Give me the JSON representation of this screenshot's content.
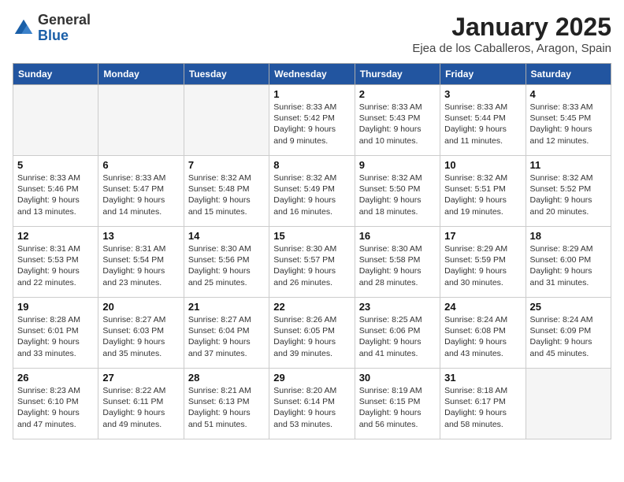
{
  "header": {
    "logo_general": "General",
    "logo_blue": "Blue",
    "month_title": "January 2025",
    "location": "Ejea de los Caballeros, Aragon, Spain"
  },
  "weekdays": [
    "Sunday",
    "Monday",
    "Tuesday",
    "Wednesday",
    "Thursday",
    "Friday",
    "Saturday"
  ],
  "weeks": [
    [
      {
        "day": "",
        "info": ""
      },
      {
        "day": "",
        "info": ""
      },
      {
        "day": "",
        "info": ""
      },
      {
        "day": "1",
        "info": "Sunrise: 8:33 AM\nSunset: 5:42 PM\nDaylight: 9 hours and 9 minutes."
      },
      {
        "day": "2",
        "info": "Sunrise: 8:33 AM\nSunset: 5:43 PM\nDaylight: 9 hours and 10 minutes."
      },
      {
        "day": "3",
        "info": "Sunrise: 8:33 AM\nSunset: 5:44 PM\nDaylight: 9 hours and 11 minutes."
      },
      {
        "day": "4",
        "info": "Sunrise: 8:33 AM\nSunset: 5:45 PM\nDaylight: 9 hours and 12 minutes."
      }
    ],
    [
      {
        "day": "5",
        "info": "Sunrise: 8:33 AM\nSunset: 5:46 PM\nDaylight: 9 hours and 13 minutes."
      },
      {
        "day": "6",
        "info": "Sunrise: 8:33 AM\nSunset: 5:47 PM\nDaylight: 9 hours and 14 minutes."
      },
      {
        "day": "7",
        "info": "Sunrise: 8:32 AM\nSunset: 5:48 PM\nDaylight: 9 hours and 15 minutes."
      },
      {
        "day": "8",
        "info": "Sunrise: 8:32 AM\nSunset: 5:49 PM\nDaylight: 9 hours and 16 minutes."
      },
      {
        "day": "9",
        "info": "Sunrise: 8:32 AM\nSunset: 5:50 PM\nDaylight: 9 hours and 18 minutes."
      },
      {
        "day": "10",
        "info": "Sunrise: 8:32 AM\nSunset: 5:51 PM\nDaylight: 9 hours and 19 minutes."
      },
      {
        "day": "11",
        "info": "Sunrise: 8:32 AM\nSunset: 5:52 PM\nDaylight: 9 hours and 20 minutes."
      }
    ],
    [
      {
        "day": "12",
        "info": "Sunrise: 8:31 AM\nSunset: 5:53 PM\nDaylight: 9 hours and 22 minutes."
      },
      {
        "day": "13",
        "info": "Sunrise: 8:31 AM\nSunset: 5:54 PM\nDaylight: 9 hours and 23 minutes."
      },
      {
        "day": "14",
        "info": "Sunrise: 8:30 AM\nSunset: 5:56 PM\nDaylight: 9 hours and 25 minutes."
      },
      {
        "day": "15",
        "info": "Sunrise: 8:30 AM\nSunset: 5:57 PM\nDaylight: 9 hours and 26 minutes."
      },
      {
        "day": "16",
        "info": "Sunrise: 8:30 AM\nSunset: 5:58 PM\nDaylight: 9 hours and 28 minutes."
      },
      {
        "day": "17",
        "info": "Sunrise: 8:29 AM\nSunset: 5:59 PM\nDaylight: 9 hours and 30 minutes."
      },
      {
        "day": "18",
        "info": "Sunrise: 8:29 AM\nSunset: 6:00 PM\nDaylight: 9 hours and 31 minutes."
      }
    ],
    [
      {
        "day": "19",
        "info": "Sunrise: 8:28 AM\nSunset: 6:01 PM\nDaylight: 9 hours and 33 minutes."
      },
      {
        "day": "20",
        "info": "Sunrise: 8:27 AM\nSunset: 6:03 PM\nDaylight: 9 hours and 35 minutes."
      },
      {
        "day": "21",
        "info": "Sunrise: 8:27 AM\nSunset: 6:04 PM\nDaylight: 9 hours and 37 minutes."
      },
      {
        "day": "22",
        "info": "Sunrise: 8:26 AM\nSunset: 6:05 PM\nDaylight: 9 hours and 39 minutes."
      },
      {
        "day": "23",
        "info": "Sunrise: 8:25 AM\nSunset: 6:06 PM\nDaylight: 9 hours and 41 minutes."
      },
      {
        "day": "24",
        "info": "Sunrise: 8:24 AM\nSunset: 6:08 PM\nDaylight: 9 hours and 43 minutes."
      },
      {
        "day": "25",
        "info": "Sunrise: 8:24 AM\nSunset: 6:09 PM\nDaylight: 9 hours and 45 minutes."
      }
    ],
    [
      {
        "day": "26",
        "info": "Sunrise: 8:23 AM\nSunset: 6:10 PM\nDaylight: 9 hours and 47 minutes."
      },
      {
        "day": "27",
        "info": "Sunrise: 8:22 AM\nSunset: 6:11 PM\nDaylight: 9 hours and 49 minutes."
      },
      {
        "day": "28",
        "info": "Sunrise: 8:21 AM\nSunset: 6:13 PM\nDaylight: 9 hours and 51 minutes."
      },
      {
        "day": "29",
        "info": "Sunrise: 8:20 AM\nSunset: 6:14 PM\nDaylight: 9 hours and 53 minutes."
      },
      {
        "day": "30",
        "info": "Sunrise: 8:19 AM\nSunset: 6:15 PM\nDaylight: 9 hours and 56 minutes."
      },
      {
        "day": "31",
        "info": "Sunrise: 8:18 AM\nSunset: 6:17 PM\nDaylight: 9 hours and 58 minutes."
      },
      {
        "day": "",
        "info": ""
      }
    ]
  ]
}
